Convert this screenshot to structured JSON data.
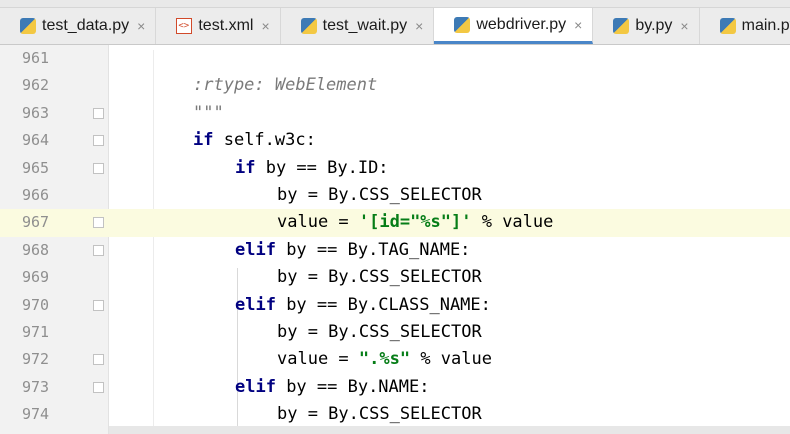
{
  "tabs": [
    {
      "label": "test_data.py",
      "icon": "python-file-icon",
      "active": false
    },
    {
      "label": "test.xml",
      "icon": "xml-file-icon",
      "active": false
    },
    {
      "label": "test_wait.py",
      "icon": "python-file-icon",
      "active": false
    },
    {
      "label": "webdriver.py",
      "icon": "python-file-icon",
      "active": true
    },
    {
      "label": "by.py",
      "icon": "python-file-icon",
      "active": false
    },
    {
      "label": "main.py",
      "icon": "python-file-icon",
      "active": false
    }
  ],
  "tab_close_glyph": "×",
  "lines": [
    {
      "num": "961",
      "text": ""
    },
    {
      "num": "962",
      "text": ":rtype: WebElement"
    },
    {
      "num": "963",
      "text": "\"\"\""
    },
    {
      "num": "964",
      "text": "if self.w3c:"
    },
    {
      "num": "965",
      "text": "if by == By.ID:"
    },
    {
      "num": "966",
      "text": "by = By.CSS_SELECTOR"
    },
    {
      "num": "967",
      "text": "value = '[id=\"%s\"]' % value"
    },
    {
      "num": "968",
      "text": "elif by == By.TAG_NAME:"
    },
    {
      "num": "969",
      "text": "by = By.CSS_SELECTOR"
    },
    {
      "num": "970",
      "text": "elif by == By.CLASS_NAME:"
    },
    {
      "num": "971",
      "text": "by = By.CSS_SELECTOR"
    },
    {
      "num": "972",
      "text": "value = \".%s\" % value"
    },
    {
      "num": "973",
      "text": "elif by == By.NAME:"
    },
    {
      "num": "974",
      "text": "by = By.CSS_SELECTOR"
    }
  ],
  "current_line": "967",
  "colors": {
    "keyword": "#000080",
    "string": "#067d17",
    "docstring": "#7a7a7a",
    "active_tab_underline": "#4a86c8"
  }
}
